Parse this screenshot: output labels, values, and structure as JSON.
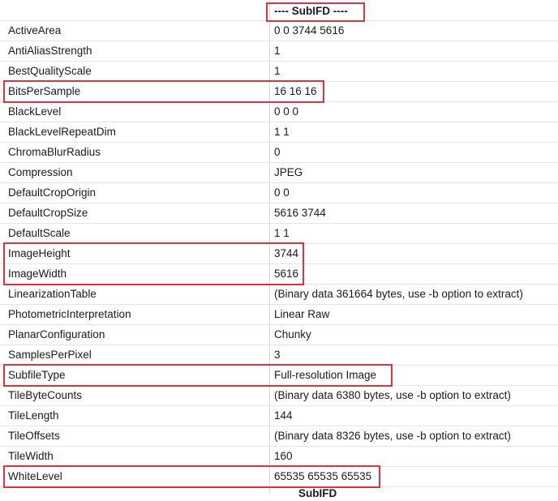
{
  "section": {
    "title": "---- SubIFD ----",
    "next_section_partial": "SubIFD"
  },
  "rows": [
    {
      "name": "ActiveArea",
      "value": "0 0 3744 5616"
    },
    {
      "name": "AntiAliasStrength",
      "value": "1"
    },
    {
      "name": "BestQualityScale",
      "value": "1"
    },
    {
      "name": "BitsPerSample",
      "value": "16 16 16"
    },
    {
      "name": "BlackLevel",
      "value": "0 0 0"
    },
    {
      "name": "BlackLevelRepeatDim",
      "value": "1 1"
    },
    {
      "name": "ChromaBlurRadius",
      "value": "0"
    },
    {
      "name": "Compression",
      "value": "JPEG"
    },
    {
      "name": "DefaultCropOrigin",
      "value": "0 0"
    },
    {
      "name": "DefaultCropSize",
      "value": "5616 3744"
    },
    {
      "name": "DefaultScale",
      "value": "1 1"
    },
    {
      "name": "ImageHeight",
      "value": "3744"
    },
    {
      "name": "ImageWidth",
      "value": "5616"
    },
    {
      "name": "LinearizationTable",
      "value": "(Binary data 361664 bytes, use -b option to extract)"
    },
    {
      "name": "PhotometricInterpretation",
      "value": "Linear Raw"
    },
    {
      "name": "PlanarConfiguration",
      "value": "Chunky"
    },
    {
      "name": "SamplesPerPixel",
      "value": "3"
    },
    {
      "name": "SubfileType",
      "value": "Full-resolution Image"
    },
    {
      "name": "TileByteCounts",
      "value": "(Binary data 6380 bytes, use -b option to extract)"
    },
    {
      "name": "TileLength",
      "value": "144"
    },
    {
      "name": "TileOffsets",
      "value": "(Binary data 8326 bytes, use -b option to extract)"
    },
    {
      "name": "TileWidth",
      "value": "160"
    },
    {
      "name": "WhiteLevel",
      "value": "65535 65535 65535"
    }
  ],
  "colors": {
    "highlight": "#d9343f",
    "grid_line": "#e4e4e4",
    "text": "#1a1a1a"
  }
}
